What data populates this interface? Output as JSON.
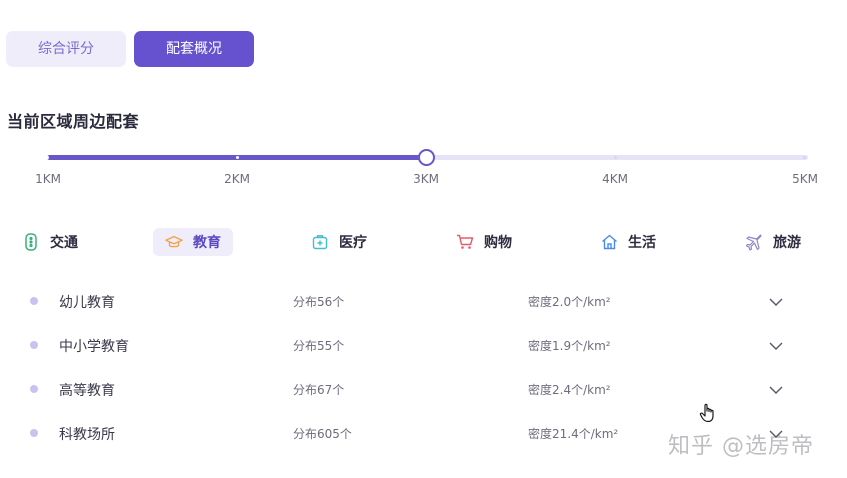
{
  "toggle": {
    "tabs": [
      {
        "label": "综合评分",
        "active": false
      },
      {
        "label": "配套概况",
        "active": true
      }
    ]
  },
  "section": {
    "title": "当前区域周边配套"
  },
  "radius_slider": {
    "ticks": [
      "1KM",
      "2KM",
      "3KM",
      "4KM",
      "5KM"
    ],
    "selected": "3KM",
    "colors": {
      "fill": "#6a55c9",
      "track": "#e5e3f5"
    }
  },
  "categories": [
    {
      "label": "交通",
      "icon": "traffic-light-icon",
      "color": "#3bb07a",
      "selected": false
    },
    {
      "label": "教育",
      "icon": "graduation-cap-icon",
      "color": "#f0a34a",
      "selected": true
    },
    {
      "label": "医疗",
      "icon": "medical-kit-icon",
      "color": "#3fbfcf",
      "selected": false
    },
    {
      "label": "购物",
      "icon": "shopping-cart-icon",
      "color": "#e8596b",
      "selected": false
    },
    {
      "label": "生活",
      "icon": "home-icon",
      "color": "#4b8bea",
      "selected": false
    },
    {
      "label": "旅游",
      "icon": "airplane-icon",
      "color": "#8f86c9",
      "selected": false
    }
  ],
  "rows": [
    {
      "name": "幼儿教育",
      "count": "分布56个",
      "density": "密度2.0个/km²"
    },
    {
      "name": "中小学教育",
      "count": "分布55个",
      "density": "密度1.9个/km²"
    },
    {
      "name": "高等教育",
      "count": "分布67个",
      "density": "密度2.4个/km²"
    },
    {
      "name": "科教场所",
      "count": "分布605个",
      "density": "密度21.4个/km²"
    }
  ],
  "watermark": "知乎 @选房帝",
  "accent_color": "#6651cf"
}
